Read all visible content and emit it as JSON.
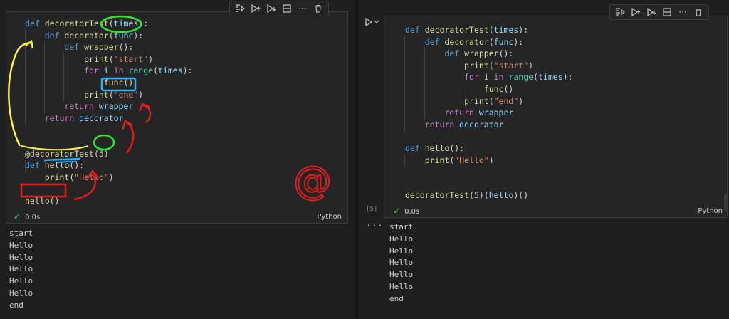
{
  "left": {
    "code_lines": [
      [
        {
          "t": "def ",
          "c": "kw"
        },
        {
          "t": "decoratorTest",
          "c": "fn"
        },
        {
          "t": "(",
          "c": "p"
        },
        {
          "t": "times",
          "c": "pm"
        },
        {
          "t": "):",
          "c": "p"
        }
      ],
      [
        {
          "t": "    "
        },
        {
          "t": "def ",
          "c": "kw"
        },
        {
          "t": "decorator",
          "c": "fn"
        },
        {
          "t": "(",
          "c": "p"
        },
        {
          "t": "func",
          "c": "pm"
        },
        {
          "t": "):",
          "c": "p"
        }
      ],
      [
        {
          "t": "        "
        },
        {
          "t": "def ",
          "c": "kw"
        },
        {
          "t": "wrapper",
          "c": "fn"
        },
        {
          "t": "():",
          "c": "p"
        }
      ],
      [
        {
          "t": "            "
        },
        {
          "t": "print",
          "c": "fn"
        },
        {
          "t": "(",
          "c": "p"
        },
        {
          "t": "\"start\"",
          "c": "st"
        },
        {
          "t": ")",
          "c": "p"
        }
      ],
      [
        {
          "t": "            "
        },
        {
          "t": "for ",
          "c": "ctl"
        },
        {
          "t": "i ",
          "c": "pm"
        },
        {
          "t": "in ",
          "c": "ctl"
        },
        {
          "t": "range",
          "c": "bi"
        },
        {
          "t": "(",
          "c": "p"
        },
        {
          "t": "times",
          "c": "pm"
        },
        {
          "t": "):",
          "c": "p"
        }
      ],
      [
        {
          "t": "                "
        },
        {
          "t": "func",
          "c": "fn"
        },
        {
          "t": "()",
          "c": "p"
        }
      ],
      [
        {
          "t": "            "
        },
        {
          "t": "print",
          "c": "fn"
        },
        {
          "t": "(",
          "c": "p"
        },
        {
          "t": "\"end\"",
          "c": "st"
        },
        {
          "t": ")",
          "c": "p"
        }
      ],
      [
        {
          "t": "        "
        },
        {
          "t": "return ",
          "c": "ctl"
        },
        {
          "t": "wrapper",
          "c": "pm"
        }
      ],
      [
        {
          "t": "    "
        },
        {
          "t": "return ",
          "c": "ctl"
        },
        {
          "t": "decorator",
          "c": "pm"
        }
      ],
      [
        {
          "t": ""
        }
      ],
      [
        {
          "t": ""
        }
      ],
      [
        {
          "t": "@decoratorTest",
          "c": "fn"
        },
        {
          "t": "(",
          "c": "p"
        },
        {
          "t": "5",
          "c": "nm"
        },
        {
          "t": ")",
          "c": "p"
        }
      ],
      [
        {
          "t": "def ",
          "c": "kw"
        },
        {
          "t": "hello",
          "c": "fn"
        },
        {
          "t": "():",
          "c": "p"
        }
      ],
      [
        {
          "t": "    "
        },
        {
          "t": "print",
          "c": "fn"
        },
        {
          "t": "(",
          "c": "p"
        },
        {
          "t": "\"Hello\"",
          "c": "st"
        },
        {
          "t": ")",
          "c": "p"
        }
      ],
      [
        {
          "t": ""
        }
      ],
      [
        {
          "t": "hello",
          "c": "fn"
        },
        {
          "t": "()",
          "c": "p"
        }
      ]
    ],
    "status_check": "✓",
    "status_time": "0.0s",
    "language": "Python",
    "output": [
      "start",
      "Hello",
      "Hello",
      "Hello",
      "Hello",
      "Hello",
      "end"
    ],
    "annotation_text": "@"
  },
  "right": {
    "code_lines": [
      [
        {
          "t": "def ",
          "c": "kw"
        },
        {
          "t": "decoratorTest",
          "c": "fn"
        },
        {
          "t": "(",
          "c": "p"
        },
        {
          "t": "times",
          "c": "pm"
        },
        {
          "t": "):",
          "c": "p"
        }
      ],
      [
        {
          "t": "    "
        },
        {
          "t": "def ",
          "c": "kw"
        },
        {
          "t": "decorator",
          "c": "fn"
        },
        {
          "t": "(",
          "c": "p"
        },
        {
          "t": "func",
          "c": "pm"
        },
        {
          "t": "):",
          "c": "p"
        }
      ],
      [
        {
          "t": "        "
        },
        {
          "t": "def ",
          "c": "kw"
        },
        {
          "t": "wrapper",
          "c": "fn"
        },
        {
          "t": "():",
          "c": "p"
        }
      ],
      [
        {
          "t": "            "
        },
        {
          "t": "print",
          "c": "fn"
        },
        {
          "t": "(",
          "c": "p"
        },
        {
          "t": "\"start\"",
          "c": "st"
        },
        {
          "t": ")",
          "c": "p"
        }
      ],
      [
        {
          "t": "            "
        },
        {
          "t": "for ",
          "c": "ctl"
        },
        {
          "t": "i ",
          "c": "pm"
        },
        {
          "t": "in ",
          "c": "ctl"
        },
        {
          "t": "range",
          "c": "bi"
        },
        {
          "t": "(",
          "c": "p"
        },
        {
          "t": "times",
          "c": "pm"
        },
        {
          "t": "):",
          "c": "p"
        }
      ],
      [
        {
          "t": "                "
        },
        {
          "t": "func",
          "c": "fn"
        },
        {
          "t": "()",
          "c": "p"
        }
      ],
      [
        {
          "t": "            "
        },
        {
          "t": "print",
          "c": "fn"
        },
        {
          "t": "(",
          "c": "p"
        },
        {
          "t": "\"end\"",
          "c": "st"
        },
        {
          "t": ")",
          "c": "p"
        }
      ],
      [
        {
          "t": "        "
        },
        {
          "t": "return ",
          "c": "ctl"
        },
        {
          "t": "wrapper",
          "c": "pm"
        }
      ],
      [
        {
          "t": "    "
        },
        {
          "t": "return ",
          "c": "ctl"
        },
        {
          "t": "decorator",
          "c": "pm"
        }
      ],
      [
        {
          "t": ""
        }
      ],
      [
        {
          "t": "def ",
          "c": "kw"
        },
        {
          "t": "hello",
          "c": "fn"
        },
        {
          "t": "():",
          "c": "p"
        }
      ],
      [
        {
          "t": "    "
        },
        {
          "t": "print",
          "c": "fn"
        },
        {
          "t": "(",
          "c": "p"
        },
        {
          "t": "\"Hello\"",
          "c": "st"
        },
        {
          "t": ")",
          "c": "p"
        }
      ],
      [
        {
          "t": ""
        }
      ],
      [
        {
          "t": ""
        }
      ],
      [
        {
          "t": "decoratorTest",
          "c": "fn"
        },
        {
          "t": "(",
          "c": "p"
        },
        {
          "t": "5",
          "c": "nm"
        },
        {
          "t": ")(",
          "c": "p"
        },
        {
          "t": "hello",
          "c": "pm"
        },
        {
          "t": ")()",
          "c": "p"
        }
      ]
    ],
    "exec_count": "[5]",
    "status_check": "✓",
    "status_time": "0.0s",
    "language": "Python",
    "output_more": "···",
    "output": [
      "start",
      "Hello",
      "Hello",
      "Hello",
      "Hello",
      "Hello",
      "end"
    ]
  },
  "toolbar_icons": [
    "run-by-line-icon",
    "execute-above-icon",
    "execute-below-icon",
    "split-cell-icon",
    "more-actions-icon",
    "delete-cell-icon"
  ],
  "colors": {
    "keyword": "#569cd6",
    "function": "#dcdcaa",
    "param": "#9cdcfe",
    "string": "#ce9178",
    "control": "#c586c0",
    "builtin": "#4ec9b0",
    "number": "#b5cea8",
    "annotation_red": "#e51c1c",
    "annotation_yellow": "#f5f53c",
    "annotation_green": "#2ee62e",
    "annotation_blue": "#28b4f0"
  }
}
